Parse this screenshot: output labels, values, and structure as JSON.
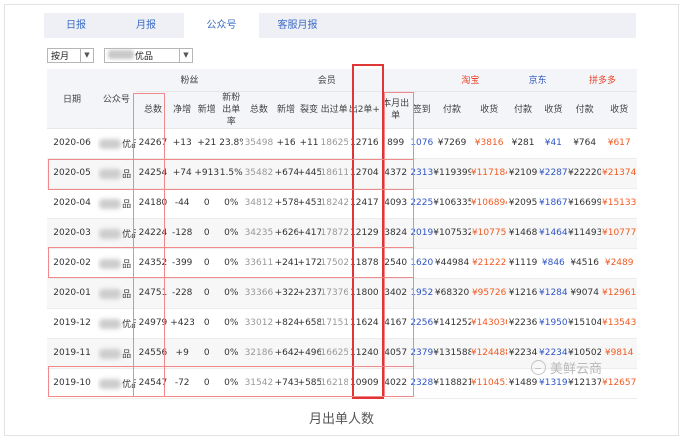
{
  "tabs": [
    {
      "label": "日报",
      "active": false
    },
    {
      "label": "月报",
      "active": false
    },
    {
      "label": "公众号",
      "active": true
    },
    {
      "label": "客服月报",
      "active": false
    }
  ],
  "filters": {
    "period": "按月",
    "account": "优品"
  },
  "header": {
    "date": "日期",
    "account": "公众号",
    "fans": "粉丝",
    "members": "会员",
    "taobao": "淘宝",
    "jd": "京东",
    "pdd": "拼多多",
    "fans_total": "总数",
    "fans_net": "净增",
    "fans_new": "新增",
    "fans_newrate": "新粉出单率",
    "mem_total": "总数",
    "mem_new": "新增",
    "mem_fission": "裂变",
    "mem_buyers": "出过单",
    "mem_orders2": "出2单+",
    "mem_month": "本月出单",
    "sign": "签到",
    "tb_pay": "付款",
    "tb_recv": "收货",
    "jd_pay": "付款",
    "jd_recv": "收货",
    "pdd_pay": "付款",
    "pdd_recv": "收货"
  },
  "rows": [
    {
      "date": "2020-06",
      "account": "优品",
      "fans_total": "24267",
      "fans_net": "+13",
      "fans_new": "+21",
      "fans_rate": "23.8%",
      "mem_total": "35498",
      "mem_new": "+16",
      "mem_fission": "+11",
      "mem_buyers": "18625",
      "mem_orders2": "12716",
      "mem_month": "899",
      "sign": "1076",
      "tb_pay": "¥7269",
      "tb_recv": "¥3816",
      "jd_pay": "¥281",
      "jd_recv": "¥41",
      "pdd_pay": "¥764",
      "pdd_recv": "¥617"
    },
    {
      "date": "2020-05",
      "account": "品",
      "fans_total": "24254",
      "fans_net": "+74",
      "fans_new": "+913",
      "fans_rate": "1.5%",
      "mem_total": "35482",
      "mem_new": "+674",
      "mem_fission": "+445",
      "mem_buyers": "18611",
      "mem_orders2": "12704",
      "mem_month": "4372",
      "sign": "2313",
      "tb_pay": "¥119399",
      "tb_recv": "¥117184",
      "jd_pay": "¥2109",
      "jd_recv": "¥2287",
      "pdd_pay": "¥22220",
      "pdd_recv": "¥21374"
    },
    {
      "date": "2020-04",
      "account": "品",
      "fans_total": "24180",
      "fans_net": "-44",
      "fans_new": "0",
      "fans_rate": "0%",
      "mem_total": "34812",
      "mem_new": "+578",
      "mem_fission": "+453",
      "mem_buyers": "18242",
      "mem_orders2": "12417",
      "mem_month": "4093",
      "sign": "2225",
      "tb_pay": "¥106335",
      "tb_recv": "¥106894",
      "jd_pay": "¥2095",
      "jd_recv": "¥1867",
      "pdd_pay": "¥16699",
      "pdd_recv": "¥15133"
    },
    {
      "date": "2020-03",
      "account": "优品",
      "fans_total": "24224",
      "fans_net": "-128",
      "fans_new": "0",
      "fans_rate": "0%",
      "mem_total": "34235",
      "mem_new": "+626",
      "mem_fission": "+417",
      "mem_buyers": "17872",
      "mem_orders2": "12129",
      "mem_month": "3824",
      "sign": "2019",
      "tb_pay": "¥107532",
      "tb_recv": "¥10775",
      "jd_pay": "¥1468",
      "jd_recv": "¥1464",
      "pdd_pay": "¥11493",
      "pdd_recv": "¥10777"
    },
    {
      "date": "2020-02",
      "account": "品",
      "fans_total": "24352",
      "fans_net": "-399",
      "fans_new": "0",
      "fans_rate": "0%",
      "mem_total": "33611",
      "mem_new": "+241",
      "mem_fission": "+172",
      "mem_buyers": "17502",
      "mem_orders2": "11878",
      "mem_month": "2540",
      "sign": "1620",
      "tb_pay": "¥44984",
      "tb_recv": "¥21222",
      "jd_pay": "¥1119",
      "jd_recv": "¥846",
      "pdd_pay": "¥4516",
      "pdd_recv": "¥2489"
    },
    {
      "date": "2020-01",
      "account": "品",
      "fans_total": "24751",
      "fans_net": "-228",
      "fans_new": "0",
      "fans_rate": "0%",
      "mem_total": "33366",
      "mem_new": "+322",
      "mem_fission": "+237",
      "mem_buyers": "17376",
      "mem_orders2": "11800",
      "mem_month": "3402",
      "sign": "1952",
      "tb_pay": "¥68320",
      "tb_recv": "¥95726",
      "jd_pay": "¥1216",
      "jd_recv": "¥1284",
      "pdd_pay": "¥9074",
      "pdd_recv": "¥12961"
    },
    {
      "date": "2019-12",
      "account": "优品",
      "fans_total": "24979",
      "fans_net": "+423",
      "fans_new": "0",
      "fans_rate": "0%",
      "mem_total": "33012",
      "mem_new": "+824",
      "mem_fission": "+658",
      "mem_buyers": "17151",
      "mem_orders2": "11624",
      "mem_month": "4167",
      "sign": "2256",
      "tb_pay": "¥141252",
      "tb_recv": "¥143030",
      "jd_pay": "¥2236",
      "jd_recv": "¥1950",
      "pdd_pay": "¥15104",
      "pdd_recv": "¥13543"
    },
    {
      "date": "2019-11",
      "account": "品",
      "fans_total": "24556",
      "fans_net": "+9",
      "fans_new": "0",
      "fans_rate": "0%",
      "mem_total": "32186",
      "mem_new": "+642",
      "mem_fission": "+496",
      "mem_buyers": "16625",
      "mem_orders2": "11240",
      "mem_month": "4057",
      "sign": "2379",
      "tb_pay": "¥131588",
      "tb_recv": "¥124488",
      "jd_pay": "¥2234",
      "jd_recv": "¥2234",
      "pdd_pay": "¥10502",
      "pdd_recv": "¥9814"
    },
    {
      "date": "2019-10",
      "account": "优品",
      "fans_total": "24547",
      "fans_net": "-72",
      "fans_new": "0",
      "fans_rate": "0%",
      "mem_total": "31542",
      "mem_new": "+743",
      "mem_fission": "+585",
      "mem_buyers": "16218",
      "mem_orders2": "10909",
      "mem_month": "4022",
      "sign": "2328",
      "tb_pay": "¥118821",
      "tb_recv": "¥110453",
      "jd_pay": "¥1489",
      "jd_recv": "¥1319",
      "pdd_pay": "¥12137",
      "pdd_recv": "¥12657"
    }
  ],
  "caption": "月出单人数",
  "watermark": "美鲜云商",
  "colors": {
    "tab_text": "#3d6cc5",
    "taobao": "#e8432a",
    "jd": "#2f56c5",
    "recv_value": "#f15a22",
    "highlight": "#e03636"
  }
}
